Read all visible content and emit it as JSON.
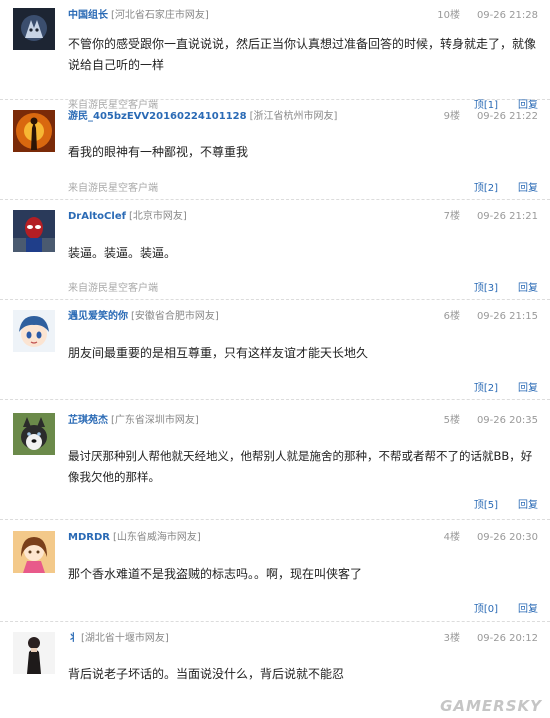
{
  "comments": [
    {
      "user": "中国组长",
      "location": "[河北省石家庄市网友]",
      "floor": "10楼",
      "time": "09-26 21:28",
      "text": "不管你的感受跟你一直说说说，然后正当你认真想过准备回答的时候，转身就走了，就像说给自己听的一样",
      "source": "来自游民星空客户端",
      "up_label": "顶[1]",
      "reply_label": "回复",
      "avatar": "dark-wolf-avatar"
    },
    {
      "user": "游民_405bzEVV20160224101128",
      "location": "[浙江省杭州市网友]",
      "floor": "9楼",
      "time": "09-26 21:22",
      "text": "看我的眼神有一种鄙视，不尊重我",
      "source": "来自游民星空客户端",
      "up_label": "顶[2]",
      "reply_label": "回复",
      "avatar": "fire-figure-avatar"
    },
    {
      "user": "DrAltoClef",
      "location": "[北京市网友]",
      "floor": "7楼",
      "time": "09-26 21:21",
      "text": "装逼。装逼。装逼。",
      "source": "来自游民星空客户端",
      "up_label": "顶[3]",
      "reply_label": "回复",
      "avatar": "spiderman-avatar"
    },
    {
      "user": "遇见爱笑的你",
      "location": "[安徽省合肥市网友]",
      "floor": "6楼",
      "time": "09-26 21:15",
      "text": "朋友间最重要的是相互尊重，只有这样友谊才能天长地久",
      "source": "",
      "up_label": "顶[2]",
      "reply_label": "回复",
      "avatar": "anime-boy-avatar"
    },
    {
      "user": "芷琪苑杰",
      "location": "[广东省深圳市网友]",
      "floor": "5楼",
      "time": "09-26 20:35",
      "text": "最讨厌那种别人帮他就天经地义，他帮别人就是施舍的那种，不帮或者帮不了的话就BB，好像我欠他的那样。",
      "source": "",
      "up_label": "顶[5]",
      "reply_label": "回复",
      "avatar": "husky-dog-avatar"
    },
    {
      "user": "MDRDR",
      "location": "[山东省威海市网友]",
      "floor": "4楼",
      "time": "09-26 20:30",
      "text": "那个香水难道不是我盗贼的标志吗。。啊，现在叫侠客了",
      "source": "",
      "up_label": "顶[0]",
      "reply_label": "回复",
      "avatar": "anime-girl-avatar"
    },
    {
      "user": "丬",
      "location": "[湖北省十堰市网友]",
      "floor": "3楼",
      "time": "09-26 20:12",
      "text": "背后说老子坏话的。当面说没什么，背后说就不能忍",
      "source": "",
      "up_label": "",
      "reply_label": "",
      "avatar": "woman-figure-avatar"
    }
  ],
  "watermark": "GAMERSKY",
  "colors": {
    "username": "#2a6ab5",
    "meta": "#999999",
    "text": "#222222"
  }
}
